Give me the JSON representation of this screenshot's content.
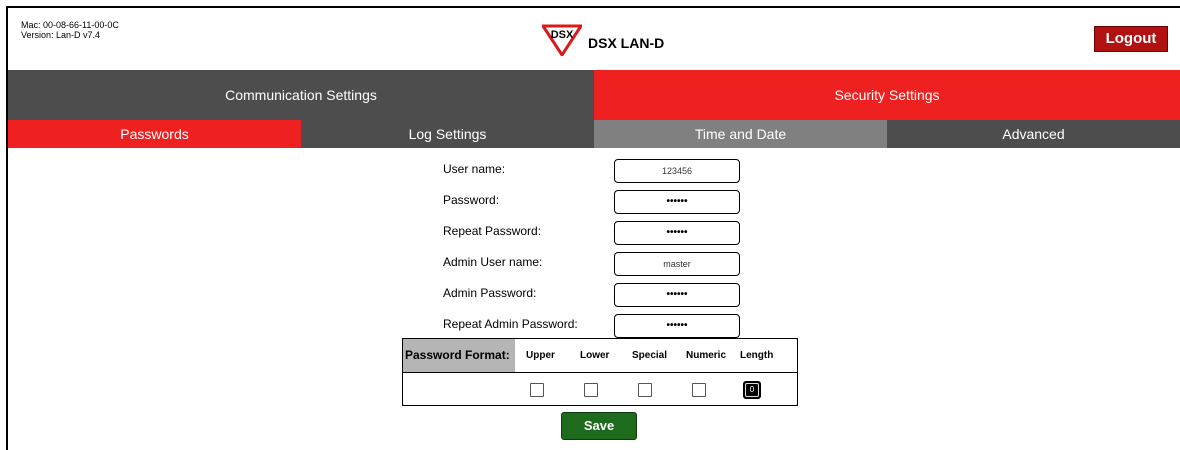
{
  "device": {
    "mac": "Mac: 00-08-66-11-00-0C",
    "version": "Version: Lan-D v7.4"
  },
  "brand": {
    "logo_text": "DSX",
    "product": "DSX LAN-D"
  },
  "header": {
    "logout_label": "Logout"
  },
  "main_tabs": [
    {
      "label": "Communication Settings",
      "active": false
    },
    {
      "label": "Security Settings",
      "active": true
    }
  ],
  "sub_tabs": [
    {
      "label": "Passwords",
      "active": true
    },
    {
      "label": "Log Settings",
      "active": false
    },
    {
      "label": "Time and Date",
      "active": false
    },
    {
      "label": "Advanced",
      "active": false
    }
  ],
  "form": {
    "fields": [
      {
        "label": "User name:",
        "value": "123456"
      },
      {
        "label": "Password:",
        "value": "••••••"
      },
      {
        "label": "Repeat Password:",
        "value": "••••••"
      },
      {
        "label": "Admin User name:",
        "value": "master"
      },
      {
        "label": "Admin Password:",
        "value": "••••••"
      },
      {
        "label": "Repeat Admin Password:",
        "value": "••••••"
      }
    ],
    "password_format": {
      "title": "Password Format:",
      "columns": [
        "Upper",
        "Lower",
        "Special",
        "Numeric",
        "Length"
      ],
      "checked": [
        false,
        false,
        false,
        false
      ],
      "length_value": "0"
    },
    "save_label": "Save"
  },
  "colors": {
    "accent_red": "#ee2020",
    "tab_dark": "#4d4d4d",
    "tab_gray": "#808080",
    "logout_red": "#b11111",
    "save_green": "#1e6b1e"
  }
}
